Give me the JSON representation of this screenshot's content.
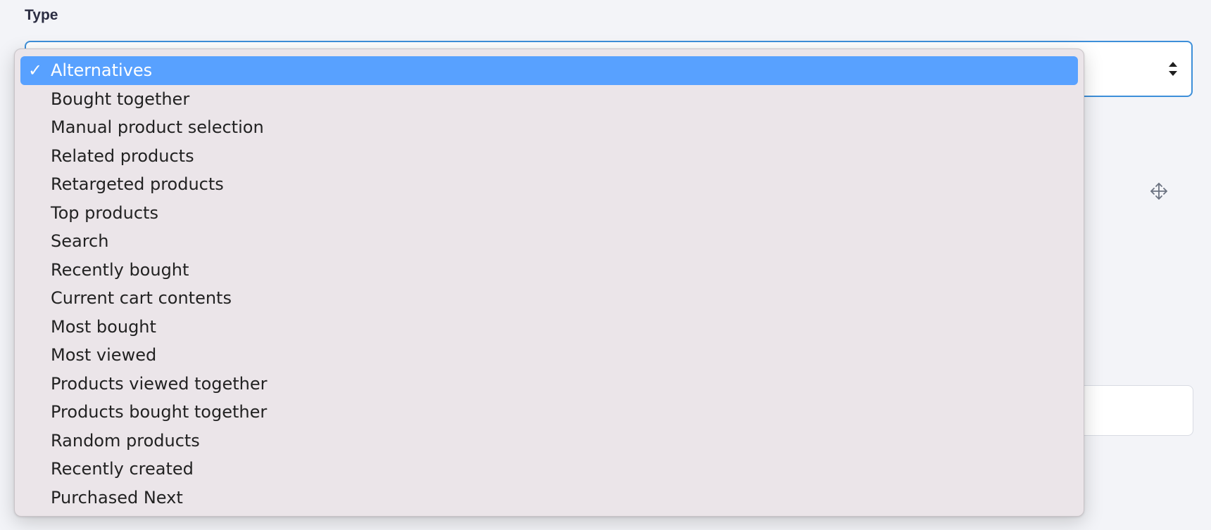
{
  "field": {
    "label": "Type"
  },
  "select": {
    "selected_index": 0
  },
  "dropdown": {
    "check_mark": "✓",
    "options": [
      "Alternatives",
      "Bought together",
      "Manual product selection",
      "Related products",
      "Retargeted products",
      "Top products",
      "Search",
      "Recently bought",
      "Current cart contents",
      "Most bought",
      "Most viewed",
      "Products viewed together",
      "Products bought together",
      "Random products",
      "Recently created",
      "Purchased Next"
    ]
  },
  "icons": {
    "select_arrow": "sort-arrows-icon",
    "move_handle": "move-arrows-icon"
  },
  "colors": {
    "focus_border": "#3d8fd9",
    "selected_option_bg": "#58a1ff",
    "dropdown_bg": "#ebe5e9"
  }
}
